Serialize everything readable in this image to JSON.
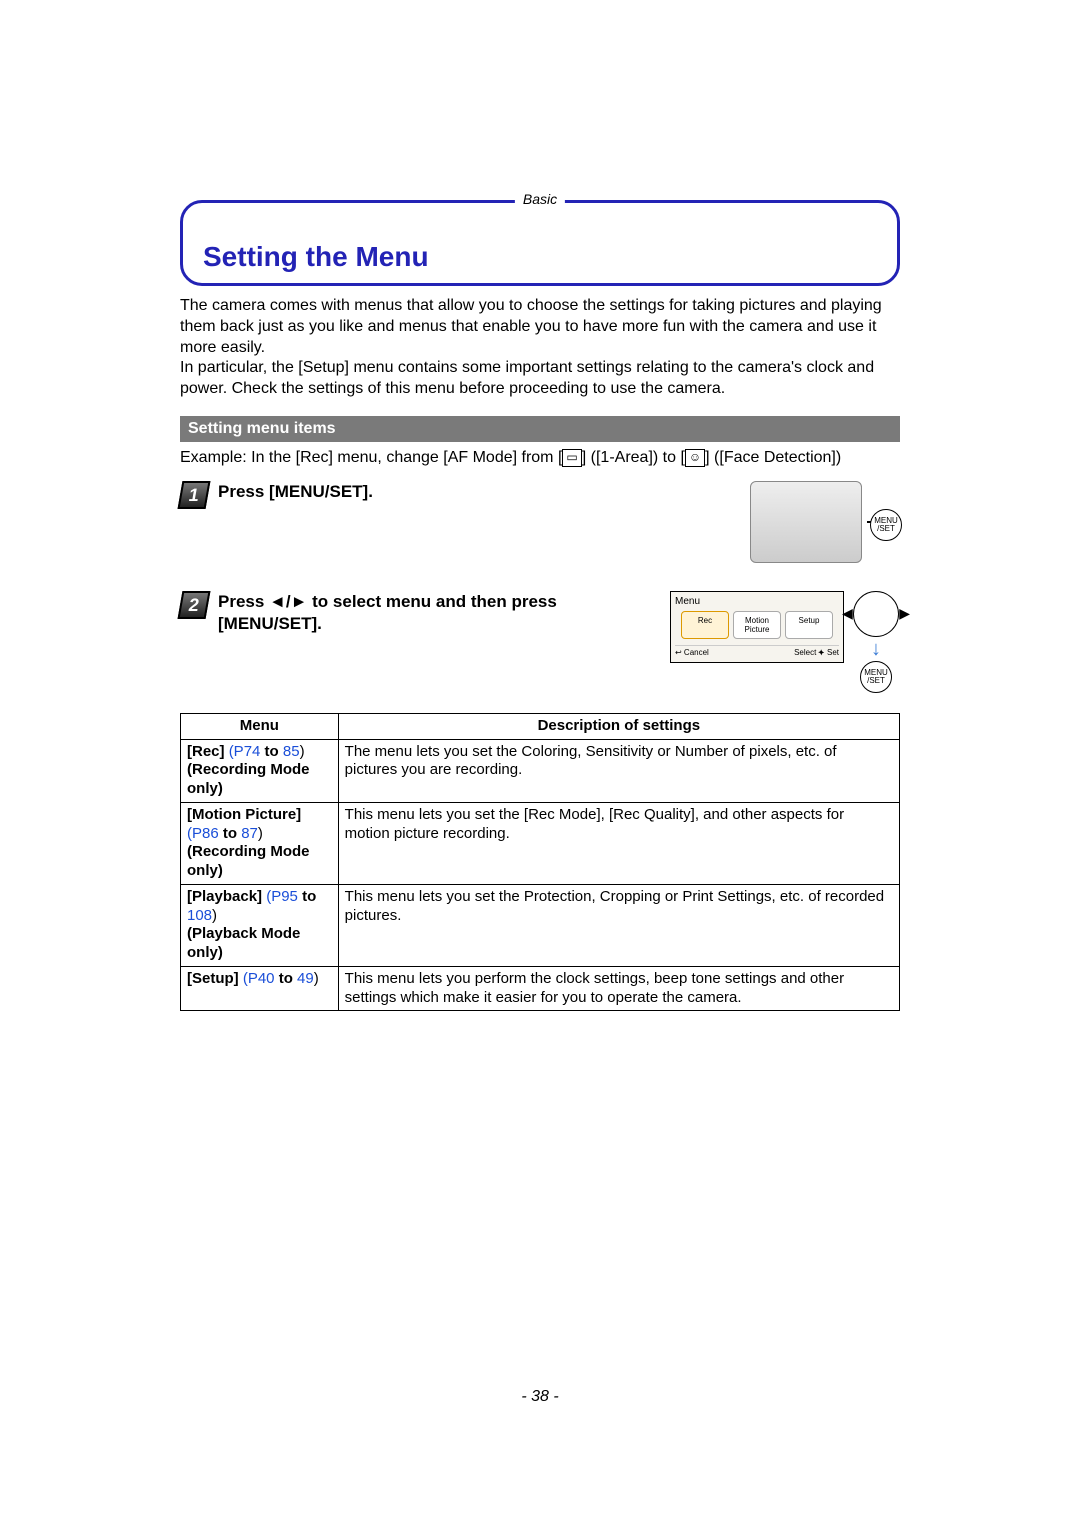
{
  "header": {
    "section_label": "Basic",
    "title": "Setting the Menu"
  },
  "intro": "The camera comes with menus that allow you to choose the settings for taking pictures and playing them back just as you like and menus that enable you to have more fun with the camera and use it more easily.\nIn particular, the [Setup] menu contains some important settings relating to the camera's clock and power. Check the settings of this menu before proceeding to use the camera.",
  "subheader": "Setting menu items",
  "example": {
    "prefix": "Example: In the [Rec] menu, change [AF Mode] from [",
    "mid": "] ([1-Area]) to [",
    "suffix": "] ([Face Detection])"
  },
  "steps": {
    "s1": {
      "num": "1",
      "text": "Press [MENU/SET].",
      "btn": "MENU\n/SET"
    },
    "s2": {
      "num": "2",
      "text": "Press ◄/► to select menu and then press [MENU/SET].",
      "btn": "MENU\n/SET"
    }
  },
  "screen": {
    "title": "Menu",
    "tabs": {
      "rec": "Rec",
      "motion": "Motion\nPicture",
      "setup": "Setup"
    },
    "cancel": "↩ Cancel",
    "select": "Select ⯌ Set"
  },
  "table": {
    "headers": {
      "menu": "Menu",
      "desc": "Description of settings"
    },
    "rows": [
      {
        "name": "[Rec]",
        "pages_pre": " P74",
        "pages_link1": "74",
        "to": " to ",
        "pages_link2": "85",
        "note": "(Recording Mode only)",
        "desc": "The menu lets you set the Coloring, Sensitivity or Number of pixels, etc. of pictures you are recording."
      },
      {
        "name": "[Motion Picture]",
        "pages_pre": " P86",
        "pages_link1": "86",
        "to": " to ",
        "pages_link2": "87",
        "note": "(Recording Mode only)",
        "desc": "This menu lets you set the [Rec Mode], [Rec Quality], and other aspects for motion picture recording."
      },
      {
        "name": "[Playback]",
        "pages_pre": " P95",
        "pages_link1": "95",
        "to": " to ",
        "pages_link2": "108",
        "note": "(Playback Mode only)",
        "desc": "This menu lets you set the Protection, Cropping or Print Settings, etc. of recorded pictures."
      },
      {
        "name": "[Setup]",
        "pages_pre": " P40",
        "pages_link1": "40",
        "to": " to ",
        "pages_link2": "49",
        "note": "",
        "desc": "This menu lets you perform the clock settings, beep tone settings and other settings which make it easier for you to operate the camera."
      }
    ]
  },
  "page_number": "- 38 -"
}
